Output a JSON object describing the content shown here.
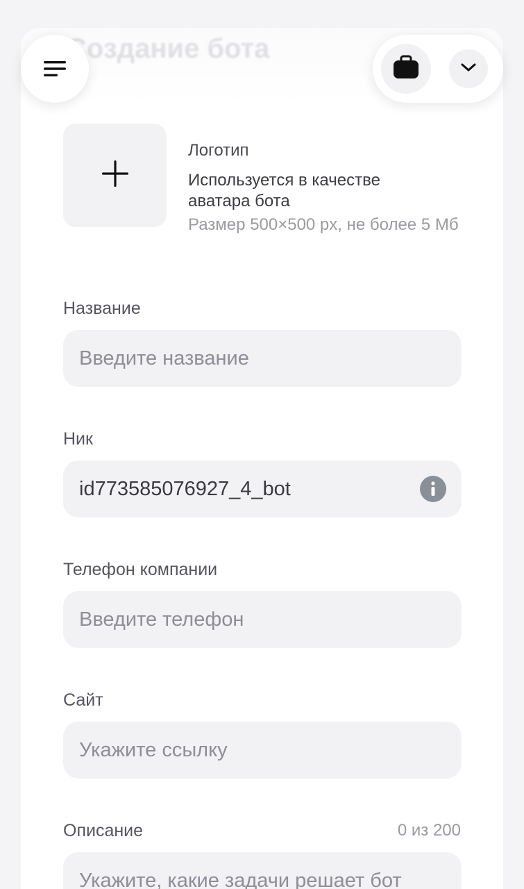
{
  "header": {
    "title": "Создание бота"
  },
  "logo": {
    "title": "Логотип",
    "description": "Используется в качестве аватара бота",
    "size_hint": "Размер 500×500 px, не более 5 Мб"
  },
  "fields": {
    "name": {
      "label": "Название",
      "placeholder": "Введите название"
    },
    "nick": {
      "label": "Ник",
      "value": "id773585076927_4_bot"
    },
    "phone": {
      "label": "Телефон компании",
      "placeholder": "Введите телефон"
    },
    "site": {
      "label": "Сайт",
      "placeholder": "Укажите ссылку"
    },
    "description": {
      "label": "Описание",
      "counter": "0 из 200",
      "placeholder": "Укажите, какие задачи решает бот"
    }
  },
  "icons": {
    "menu": "menu-icon",
    "bag": "briefcase-icon",
    "chevron": "chevron-down-icon",
    "plus": "plus-icon",
    "info": "info-icon"
  },
  "colors": {
    "background": "#f4f4f6",
    "card": "#ffffff",
    "input_bg": "#f2f2f4",
    "placeholder": "#8e8e96",
    "info_icon": "#8a8f98"
  }
}
